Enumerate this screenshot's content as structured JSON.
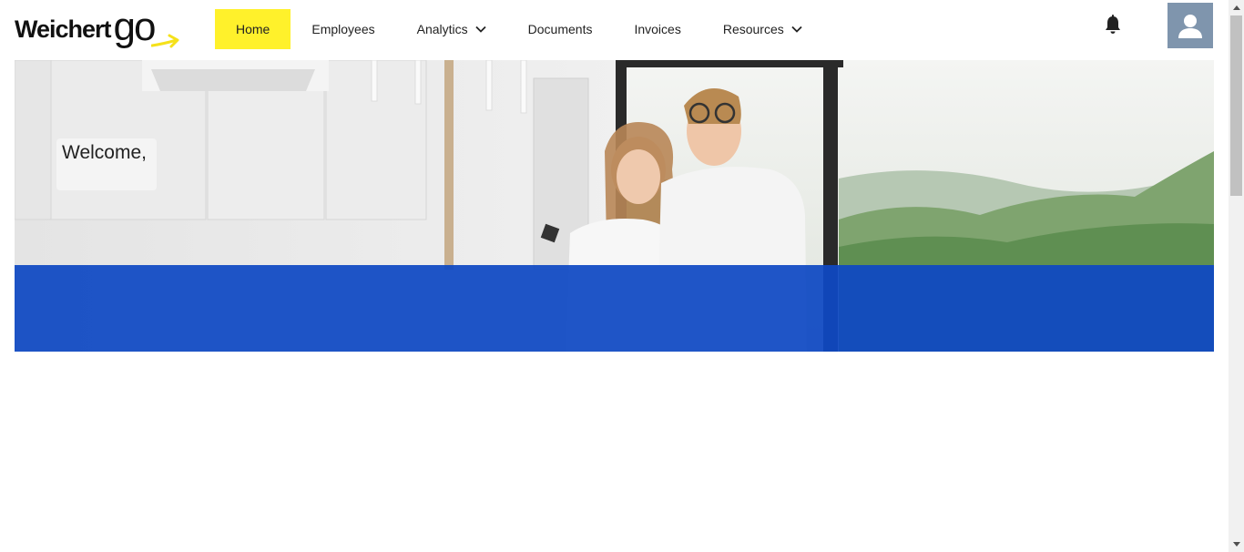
{
  "brand": {
    "name": "Weichert",
    "suffix": "go",
    "accent_color": "#fff12b",
    "arrow_color": "#f5e11a"
  },
  "nav": {
    "items": [
      {
        "label": "Home",
        "active": true,
        "has_dropdown": false
      },
      {
        "label": "Employees",
        "active": false,
        "has_dropdown": false
      },
      {
        "label": "Analytics",
        "active": false,
        "has_dropdown": true
      },
      {
        "label": "Documents",
        "active": false,
        "has_dropdown": false
      },
      {
        "label": "Invoices",
        "active": false,
        "has_dropdown": false
      },
      {
        "label": "Resources",
        "active": false,
        "has_dropdown": true
      }
    ]
  },
  "header_icons": {
    "notifications": "bell-icon",
    "profile": "user-icon",
    "avatar_color": "#7f95ad"
  },
  "hero": {
    "welcome_text": "Welcome,",
    "band_color": "#0e48c3"
  }
}
